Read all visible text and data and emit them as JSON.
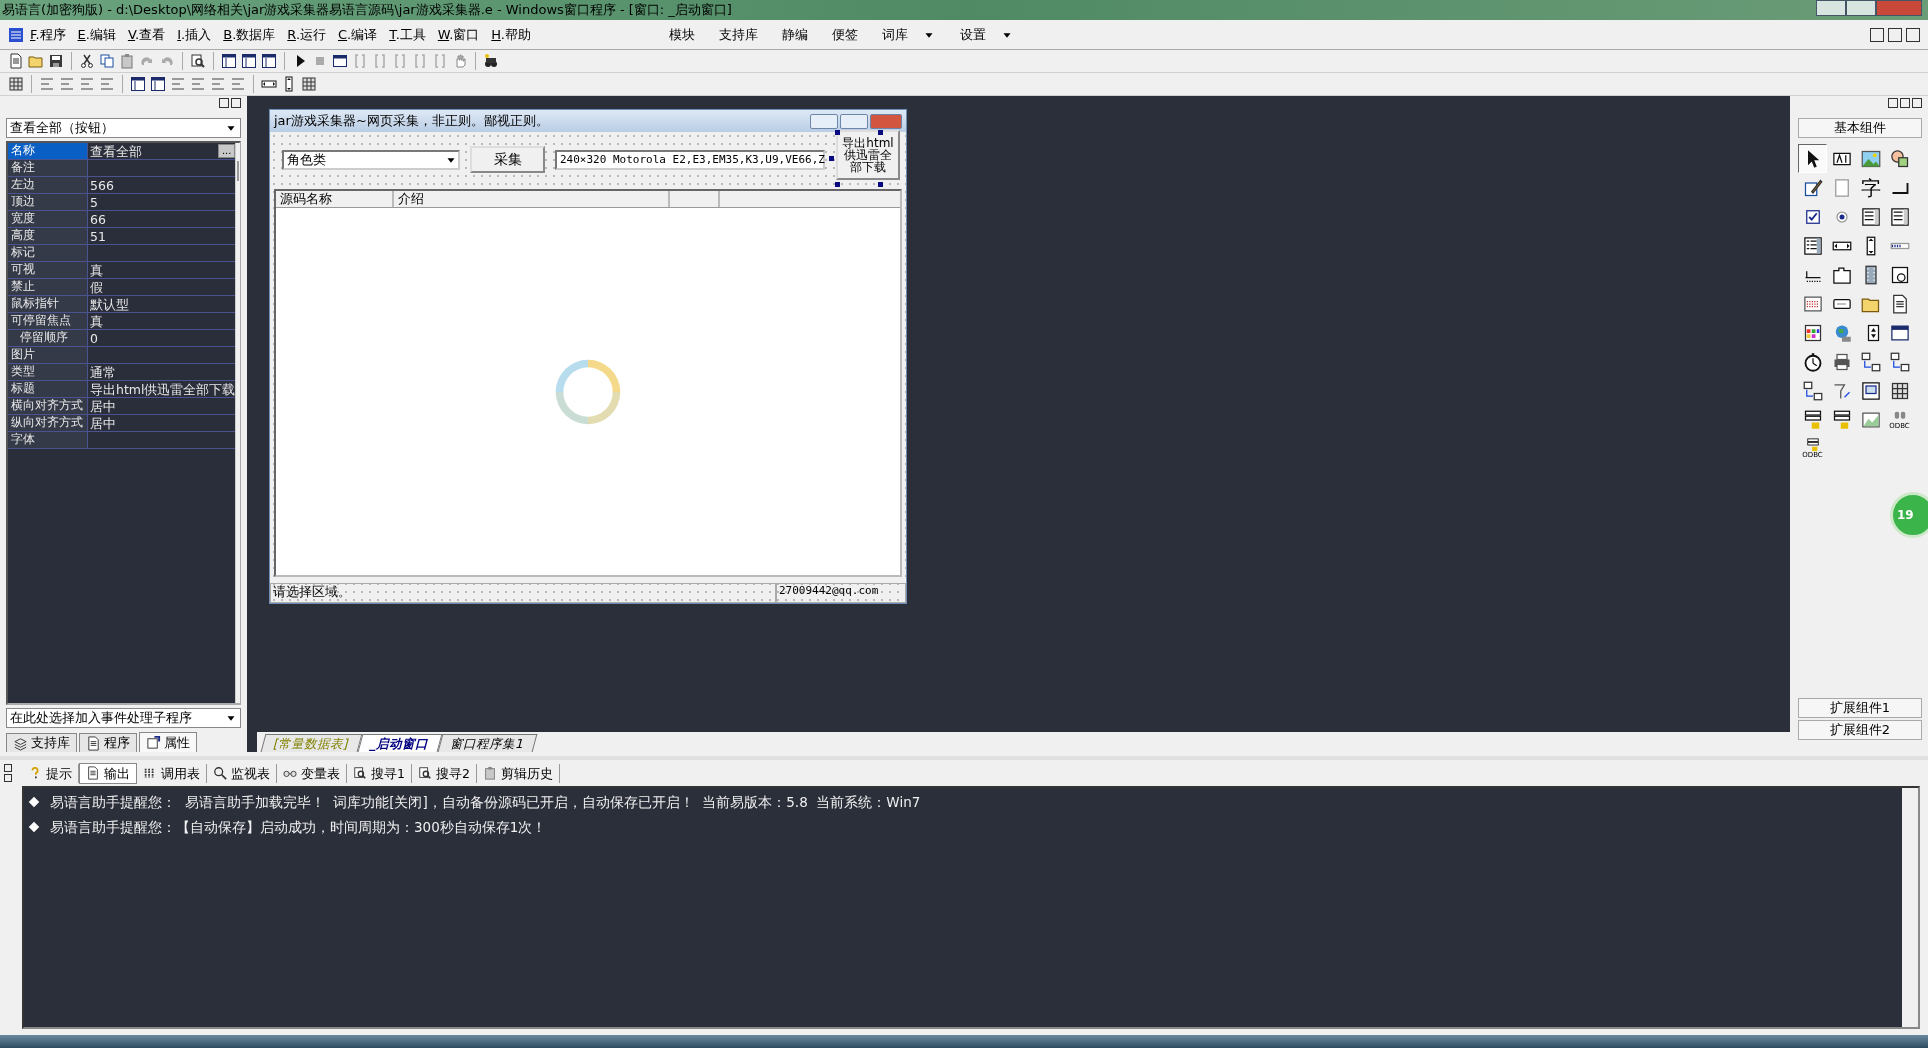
{
  "window": {
    "title": "易语言(加密狗版) - d:\\Desktop\\网络相关\\jar游戏采集器易语言源码\\jar游戏采集器.e - Windows窗口程序 - [窗口: _启动窗口]"
  },
  "menu": [
    {
      "key": "F",
      "label": ".程序"
    },
    {
      "key": "E",
      "label": ".编辑"
    },
    {
      "key": "V",
      "label": ".查看"
    },
    {
      "key": "I",
      "label": ".插入"
    },
    {
      "key": "B",
      "label": ".数据库"
    },
    {
      "key": "R",
      "label": ".运行"
    },
    {
      "key": "C",
      "label": ".编译"
    },
    {
      "key": "T",
      "label": ".工具"
    },
    {
      "key": "W",
      "label": ".窗口"
    },
    {
      "key": "H",
      "label": ".帮助"
    }
  ],
  "quick_menu": [
    {
      "label": "模块",
      "dropdown": false
    },
    {
      "label": "支持库",
      "dropdown": false
    },
    {
      "label": "静编",
      "dropdown": false
    },
    {
      "label": "便签",
      "dropdown": false
    },
    {
      "label": "词库",
      "dropdown": true
    },
    {
      "label": "设置",
      "dropdown": true
    }
  ],
  "properties": {
    "selector": "查看全部（按钮）",
    "rows": [
      {
        "name": "名称",
        "value": "查看全部",
        "selected": true,
        "button": "..."
      },
      {
        "name": "备注",
        "value": "",
        "selected": false
      },
      {
        "name": "左边",
        "value": "566",
        "selected": false
      },
      {
        "name": "顶边",
        "value": "5",
        "selected": false
      },
      {
        "name": "宽度",
        "value": "66",
        "selected": false
      },
      {
        "name": "高度",
        "value": "51",
        "selected": false
      },
      {
        "name": "标记",
        "value": "",
        "selected": false
      },
      {
        "name": "可视",
        "value": "真",
        "selected": false
      },
      {
        "name": "禁止",
        "value": "假",
        "selected": false
      },
      {
        "name": "鼠标指针",
        "value": "默认型",
        "selected": false
      },
      {
        "name": "可停留焦点",
        "value": "真",
        "selected": false,
        "children": [
          {
            "name": "停留顺序",
            "value": "0",
            "selected": false
          }
        ]
      },
      {
        "name": "图片",
        "value": "",
        "selected": false
      },
      {
        "name": "类型",
        "value": "通常",
        "selected": false
      },
      {
        "name": "标题",
        "value": "导出html供迅雷全部下载",
        "selected": false
      },
      {
        "name": "横向对齐方式",
        "value": "居中",
        "selected": false
      },
      {
        "name": "纵向对齐方式",
        "value": "居中",
        "selected": false
      },
      {
        "name": "字体",
        "value": "",
        "selected": false
      }
    ],
    "event_selector": "在此处选择加入事件处理子程序"
  },
  "left_tabs": [
    {
      "label": "支持库",
      "selected": false
    },
    {
      "label": "程序",
      "selected": false
    },
    {
      "label": "属性",
      "selected": true
    }
  ],
  "designer": {
    "title": "jar游戏采集器~网页采集，非正则。鄙视正则。",
    "category": "角色类",
    "collect_button": "采集",
    "model": "240×320 Motorola E2,E3,EM35,K3,U9,VE66,Z",
    "export_button": {
      "label": "导出html供迅雷全部下载",
      "selected": true
    },
    "columns": [
      "源码名称",
      "介绍"
    ],
    "status": [
      "请选择区域。",
      "27009442@qq.com"
    ]
  },
  "editor_tabs": [
    {
      "label": "[常量数据表]",
      "selected": false,
      "color": "#808000"
    },
    {
      "label": "_启动窗口",
      "selected": true,
      "color": "#000080"
    },
    {
      "label": "窗口程序集1",
      "selected": false,
      "color": "#000000"
    }
  ],
  "toolbox": {
    "title": "基本组件",
    "tools": [
      {
        "selected": true
      },
      {
        "selected": false
      },
      {
        "selected": false
      },
      {
        "selected": false
      },
      {
        "selected": false
      },
      {
        "selected": false
      },
      {
        "selected": false,
        "glyph": "字"
      },
      {
        "selected": false
      },
      {
        "selected": false
      },
      {
        "selected": false
      },
      {
        "selected": false
      },
      {
        "selected": false
      },
      {
        "selected": false
      },
      {
        "selected": false
      },
      {
        "selected": false
      },
      {
        "selected": false
      },
      {
        "selected": false
      },
      {
        "selected": false
      },
      {
        "selected": false
      },
      {
        "selected": false
      },
      {
        "selected": false
      },
      {
        "selected": false
      },
      {
        "selected": false
      },
      {
        "selected": false
      },
      {
        "selected": false
      },
      {
        "selected": false
      },
      {
        "selected": false
      },
      {
        "selected": false
      },
      {
        "selected": false
      },
      {
        "selected": false
      },
      {
        "selected": false
      },
      {
        "selected": false
      },
      {
        "selected": false
      },
      {
        "selected": false
      },
      {
        "selected": false
      },
      {
        "selected": false
      },
      {
        "selected": false
      },
      {
        "selected": false
      },
      {
        "selected": false
      },
      {
        "selected": false,
        "glyph": "ODBC"
      },
      {
        "selected": false,
        "glyph": "ODBC"
      }
    ],
    "groups": [
      "扩展组件1",
      "扩展组件2"
    ]
  },
  "badge": "19",
  "output_tabs": [
    {
      "label": "提示",
      "selected": false
    },
    {
      "label": "输出",
      "selected": true
    },
    {
      "label": "调用表",
      "selected": false
    },
    {
      "label": "监视表",
      "selected": false
    },
    {
      "label": "变量表",
      "selected": false
    },
    {
      "label": "搜寻1",
      "selected": false
    },
    {
      "label": "搜寻2",
      "selected": false
    },
    {
      "label": "剪辑历史",
      "selected": false
    }
  ],
  "messages": [
    "易语言助手提醒您：  易语言助手加载完毕！  词库功能[关闭]，自动备份源码已开启，自动保存已开启！  当前易版本：5.8  当前系统：Win7",
    "易语言助手提醒您：【自动保存】启动成功，时间周期为：300秒自动保存1次！"
  ]
}
